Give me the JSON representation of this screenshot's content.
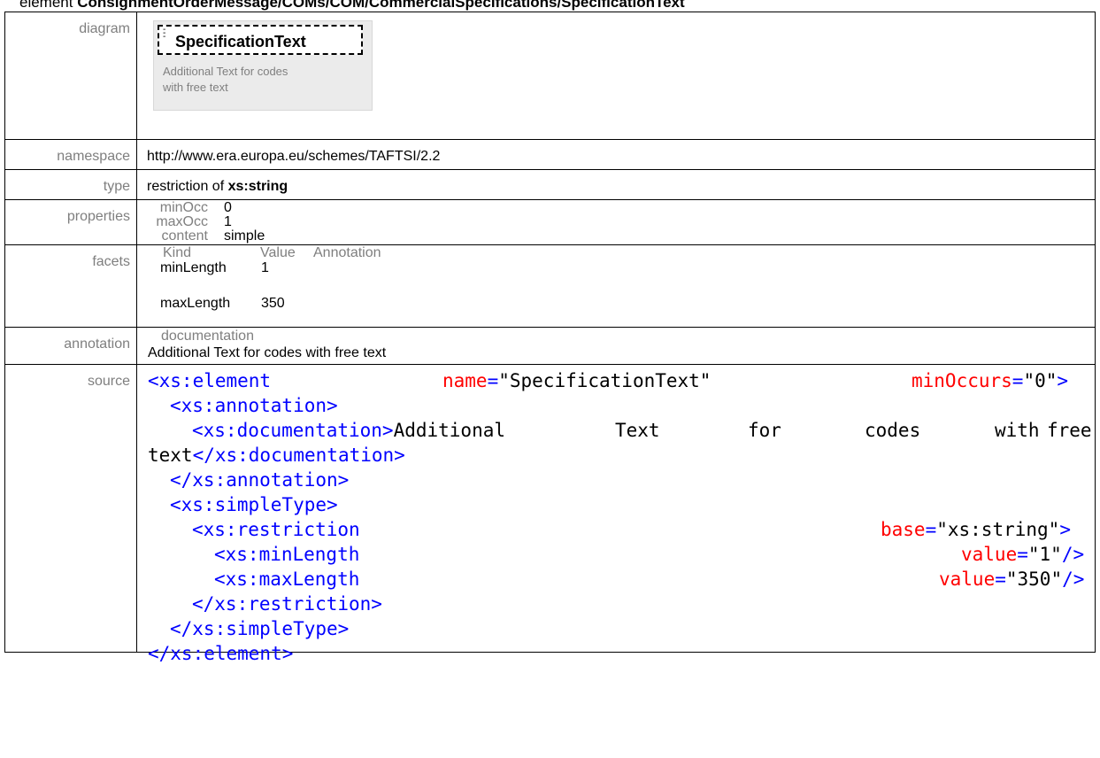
{
  "header": {
    "prefix": "element ",
    "path": "ConsignmentOrderMessage/COMs/COM/CommercialSpecifications/SpecificationText"
  },
  "labels": {
    "diagram": "diagram",
    "namespace": "namespace",
    "type": "type",
    "properties": "properties",
    "facets": "facets",
    "annotation": "annotation",
    "source": "source"
  },
  "diagram": {
    "element_name": "SpecificationText",
    "doc_line1": "Additional Text for codes",
    "doc_line2": "with free text"
  },
  "namespace": "http://www.era.europa.eu/schemes/TAFTSI/2.2",
  "type": {
    "prefix": "restriction of ",
    "base": "xs:string"
  },
  "properties": [
    {
      "key": "minOcc",
      "value": "0"
    },
    {
      "key": "maxOcc",
      "value": "1"
    },
    {
      "key": "content",
      "value": "simple"
    }
  ],
  "facets": {
    "headers": [
      "Kind",
      "Value",
      "Annotation"
    ],
    "rows": [
      {
        "kind": "minLength",
        "value": "1"
      },
      {
        "kind": "maxLength",
        "value": "350"
      }
    ]
  },
  "annotation": {
    "label": "documentation",
    "text": "Additional Text for codes with free text"
  },
  "source": {
    "l1_open": "<xs:element",
    "l1_attr1": "name",
    "l1_val1": "\"SpecificationText\"",
    "l1_attr2": "minOccurs",
    "l1_val2": "\"0\"",
    "l1_close": ">",
    "l2": "<xs:annotation>",
    "l3_open": "<xs:documentation>",
    "l3_w1": "Additional",
    "l3_w2": "Text",
    "l3_w3": "for",
    "l3_w4": "codes",
    "l3_w5": "with",
    "l3_w6": "free",
    "l4_text": "text",
    "l4_close": "</xs:documentation>",
    "l5": "</xs:annotation>",
    "l6": "<xs:simpleType>",
    "l7_open": "<xs:restriction",
    "l7_attr": "base",
    "l7_val": "\"xs:string\"",
    "l7_close": ">",
    "l8_open": "<xs:minLength",
    "l8_attr": "value",
    "l8_val": "\"1\"",
    "l8_close": "/>",
    "l9_open": "<xs:maxLength",
    "l9_attr": "value",
    "l9_val": "\"350\"",
    "l9_close": "/>",
    "l10": "</xs:restriction>",
    "l11": "</xs:simpleType>",
    "l12": "</xs:element>",
    "eq": "="
  }
}
